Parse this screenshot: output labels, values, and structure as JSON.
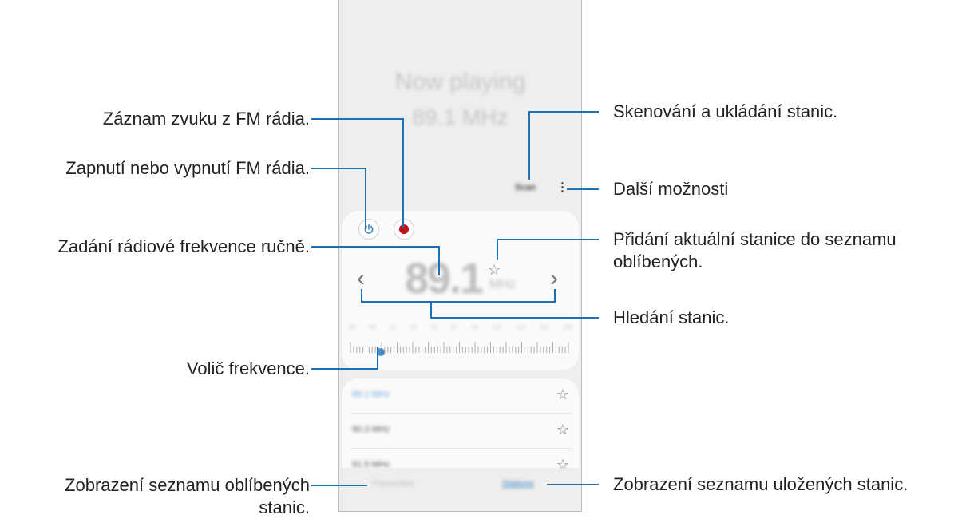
{
  "screen": {
    "now_playing_title": "Now playing",
    "now_playing_freq": "89.1 MHz",
    "scan_label": "Scan",
    "more_icon": "⋮",
    "freq_value": "89.1",
    "freq_unit": "MHz",
    "tick_labels": [
      "88",
      "89",
      "91",
      "93",
      "95",
      "97",
      "99",
      "101",
      "103",
      "105",
      "108"
    ],
    "stations": [
      {
        "freq": "89.1 MHz",
        "active": true
      },
      {
        "freq": "90.3 MHz",
        "active": false
      },
      {
        "freq": "91.5 MHz",
        "active": false
      }
    ],
    "tabs": {
      "favorites": "Favourites",
      "stations": "Stations"
    },
    "colors": {
      "accent": "#3b86c5",
      "record": "#c0111b",
      "callout": "#1f6fb2"
    }
  },
  "callouts": {
    "record": "Záznam zvuku z FM rádia.",
    "power": "Zapnutí nebo vypnutí FM rádia.",
    "manual": "Zadání rádiové frekvence ručně.",
    "dial": "Volič frekvence.",
    "favorites_1": "Zobrazení seznamu oblíbených",
    "favorites_2": "stanic.",
    "scan": "Skenování a ukládání stanic.",
    "more": "Další možnosti",
    "add_fav_1": "Přidání aktuální stanice do seznamu",
    "add_fav_2": "oblíbených.",
    "search": "Hledání stanic.",
    "saved": "Zobrazení seznamu uložených stanic."
  }
}
